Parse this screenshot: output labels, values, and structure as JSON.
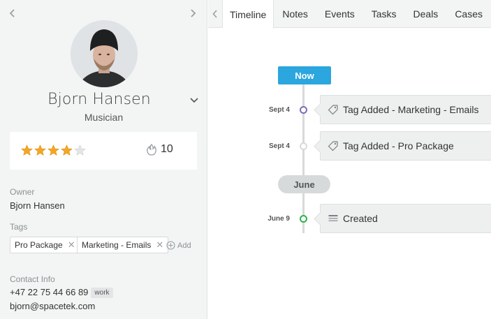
{
  "contact": {
    "name": "Bjorn Hansen",
    "title": "Musician",
    "rating": 4,
    "rating_max": 5,
    "heat": "10"
  },
  "owner": {
    "label": "Owner",
    "value": "Bjorn Hansen"
  },
  "tags": {
    "label": "Tags",
    "items": [
      {
        "label": "Pro Package",
        "remove": "✕"
      },
      {
        "label": "Marketing - Emails",
        "remove": "✕"
      }
    ],
    "add_label": "Add"
  },
  "contact_info": {
    "label": "Contact Info",
    "phone": "+47 22 75 44 66 89",
    "phone_type": "work",
    "email": "bjorn@spacetek.com"
  },
  "tabs": [
    "Timeline",
    "Notes",
    "Events",
    "Tasks",
    "Deals",
    "Cases"
  ],
  "timeline": {
    "now_label": "Now",
    "month_label": "June",
    "entries": [
      {
        "date": "Sept 4",
        "text": "Tag Added - Marketing - Emails",
        "icon": "tag-icon",
        "dot_color": "#7c6cc0",
        "dot_fill": "#fff"
      },
      {
        "date": "Sept 4",
        "text": "Tag Added - Pro Package",
        "icon": "tag-icon",
        "dot_color": "#d7dadb",
        "dot_fill": "#fff"
      },
      {
        "date": "June 9",
        "text": "Created",
        "icon": "list-icon",
        "dot_color": "#2fb24a",
        "dot_fill": "#fff"
      }
    ]
  },
  "colors": {
    "accent": "#2ba6de",
    "star": "#f5a623",
    "created_dot": "#2fb24a",
    "tag_dot": "#7c6cc0"
  }
}
